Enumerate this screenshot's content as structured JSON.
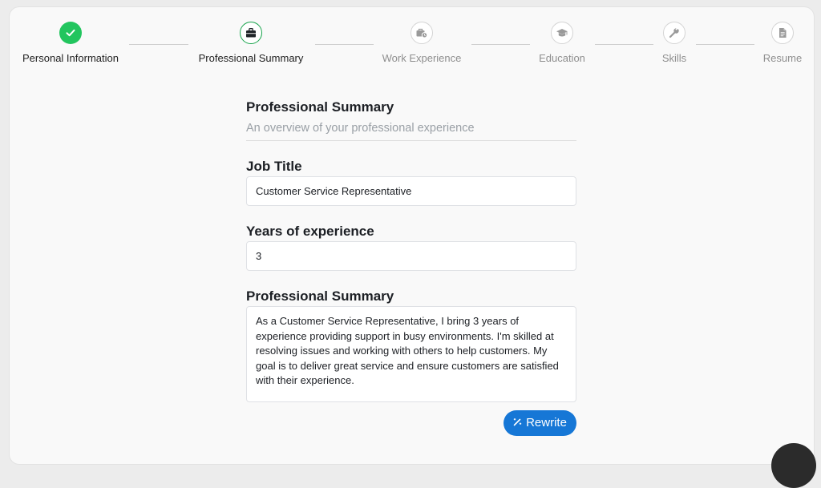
{
  "stepper": {
    "steps": [
      {
        "label": "Personal Information",
        "state": "done",
        "icon": "check-icon"
      },
      {
        "label": "Professional Summary",
        "state": "active",
        "icon": "briefcase-icon"
      },
      {
        "label": "Work Experience",
        "state": "todo",
        "icon": "work-experience-icon"
      },
      {
        "label": "Education",
        "state": "todo",
        "icon": "graduation-cap-icon"
      },
      {
        "label": "Skills",
        "state": "todo",
        "icon": "wrench-icon"
      },
      {
        "label": "Resume",
        "state": "todo",
        "icon": "document-icon"
      }
    ]
  },
  "section": {
    "title": "Professional Summary",
    "subtitle": "An overview of your professional experience"
  },
  "fields": {
    "job_title": {
      "label": "Job Title",
      "value": "Customer Service Representative"
    },
    "years": {
      "label": "Years of experience",
      "value": "3"
    },
    "summary": {
      "label": "Professional Summary",
      "value": "As a Customer Service Representative, I bring 3 years of experience providing support in busy environments. I'm skilled at resolving issues and working with others to help customers. My goal is to deliver great service and ensure customers are satisfied with their experience."
    }
  },
  "actions": {
    "rewrite_label": "Rewrite",
    "rewrite_icon": "magic-wand-icon"
  },
  "colors": {
    "accent": "#1677d6",
    "success": "#22c55e",
    "active_ring": "#16a34a"
  }
}
